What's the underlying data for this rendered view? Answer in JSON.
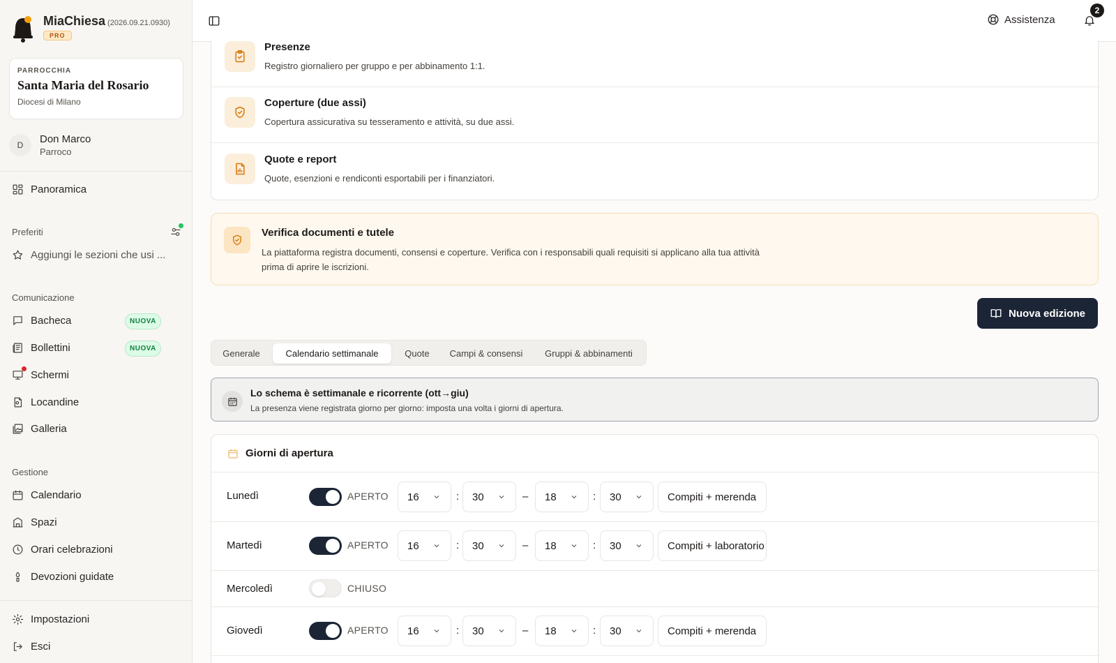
{
  "app": {
    "name": "MiaChiesa",
    "version": "(2026.09.21.0930)",
    "plan_badge": "PRO"
  },
  "parish": {
    "kicker": "PARROCCHIA",
    "name": "Santa Maria del Rosario",
    "diocese": "Diocesi di Milano"
  },
  "user": {
    "initial": "D",
    "name": "Don Marco",
    "role": "Parroco"
  },
  "sidebar": {
    "overview": "Panoramica",
    "favorites_label": "Preferiti",
    "favorites_empty": "Aggiungi le sezioni che usi ...",
    "communication_label": "Comunicazione",
    "communication": [
      {
        "label": "Bacheca",
        "badge": "NUOVA"
      },
      {
        "label": "Bollettini",
        "badge": "NUOVA"
      },
      {
        "label": "Schermi"
      },
      {
        "label": "Locandine"
      },
      {
        "label": "Galleria"
      }
    ],
    "management_label": "Gestione",
    "management": [
      {
        "label": "Calendario"
      },
      {
        "label": "Spazi"
      },
      {
        "label": "Orari celebrazioni"
      },
      {
        "label": "Devozioni guidate"
      }
    ],
    "settings": "Impostazioni",
    "logout": "Esci"
  },
  "topbar": {
    "help": "Assistenza",
    "notifications_count": "2"
  },
  "features": [
    {
      "title": "Presenze",
      "desc": "Registro giornaliero per gruppo e per abbinamento 1:1."
    },
    {
      "title": "Coperture (due assi)",
      "desc": "Copertura assicurativa su tesseramento e attività, su due assi."
    },
    {
      "title": "Quote e report",
      "desc": "Quote, esenzioni e rendiconti esportabili per i finanziatori."
    }
  ],
  "notice": {
    "title": "Verifica documenti e tutele",
    "text": "La piattaforma registra documenti, consensi e coperture. Verifica con i responsabili quali requisiti si applicano alla tua attività prima di aprire le iscrizioni."
  },
  "new_edition_button": "Nuova edizione",
  "tabs": [
    "Generale",
    "Calendario settimanale",
    "Quote",
    "Campi & consensi",
    "Gruppi & abbinamenti"
  ],
  "active_tab": "Calendario settimanale",
  "schema_info": {
    "title": "Lo schema è settimanale e ricorrente (ott→giu)",
    "subtitle": "La presenza viene registrata giorno per giorno: imposta una volta i giorni di apertura."
  },
  "opening_days": {
    "title": "Giorni di apertura",
    "separator_colon": ":",
    "separator_dash": "–",
    "days": [
      {
        "name": "Lunedì",
        "open": true,
        "state": "APERTO",
        "start_h": "16",
        "start_m": "30",
        "end_h": "18",
        "end_m": "30",
        "note": "Compiti + merenda"
      },
      {
        "name": "Martedì",
        "open": true,
        "state": "APERTO",
        "start_h": "16",
        "start_m": "30",
        "end_h": "18",
        "end_m": "30",
        "note": "Compiti + laboratorio"
      },
      {
        "name": "Mercoledì",
        "open": false,
        "state": "CHIUSO"
      },
      {
        "name": "Giovedì",
        "open": true,
        "state": "APERTO",
        "start_h": "16",
        "start_m": "30",
        "end_h": "18",
        "end_m": "30",
        "note": "Compiti + merenda"
      }
    ]
  },
  "colors": {
    "accent_dark": "#1c2536",
    "amber_soft": "#fbeedb",
    "new_badge_green": "#15803d",
    "notification_dot": "#dc2626"
  }
}
